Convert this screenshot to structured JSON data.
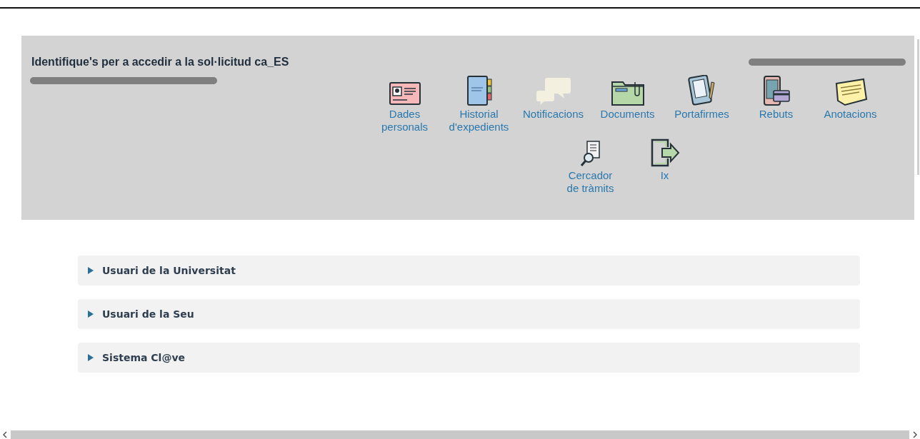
{
  "header": {
    "title": "Identifique's per a accedir a la sol·licitud ca_ES"
  },
  "menu": [
    {
      "label": "Dades\npersonals",
      "kind": "id-card"
    },
    {
      "label": "Historial\nd'expedients",
      "kind": "binder"
    },
    {
      "label": "Notificacions",
      "kind": "chat"
    },
    {
      "label": "Documents",
      "kind": "folder"
    },
    {
      "label": "Portafirmes",
      "kind": "tablet"
    },
    {
      "label": "Rebuts",
      "kind": "payment"
    },
    {
      "label": "Anotacions",
      "kind": "note"
    },
    {
      "label": "Cercador\nde tràmits",
      "kind": "search-doc"
    },
    {
      "label": "Ix",
      "kind": "exit"
    }
  ],
  "login_options": [
    {
      "label": "Usuari de la Universitat",
      "expanded": false
    },
    {
      "label": "Usuari de la Seu",
      "expanded": false
    },
    {
      "label": "Sistema Cl@ve",
      "expanded": false
    }
  ]
}
